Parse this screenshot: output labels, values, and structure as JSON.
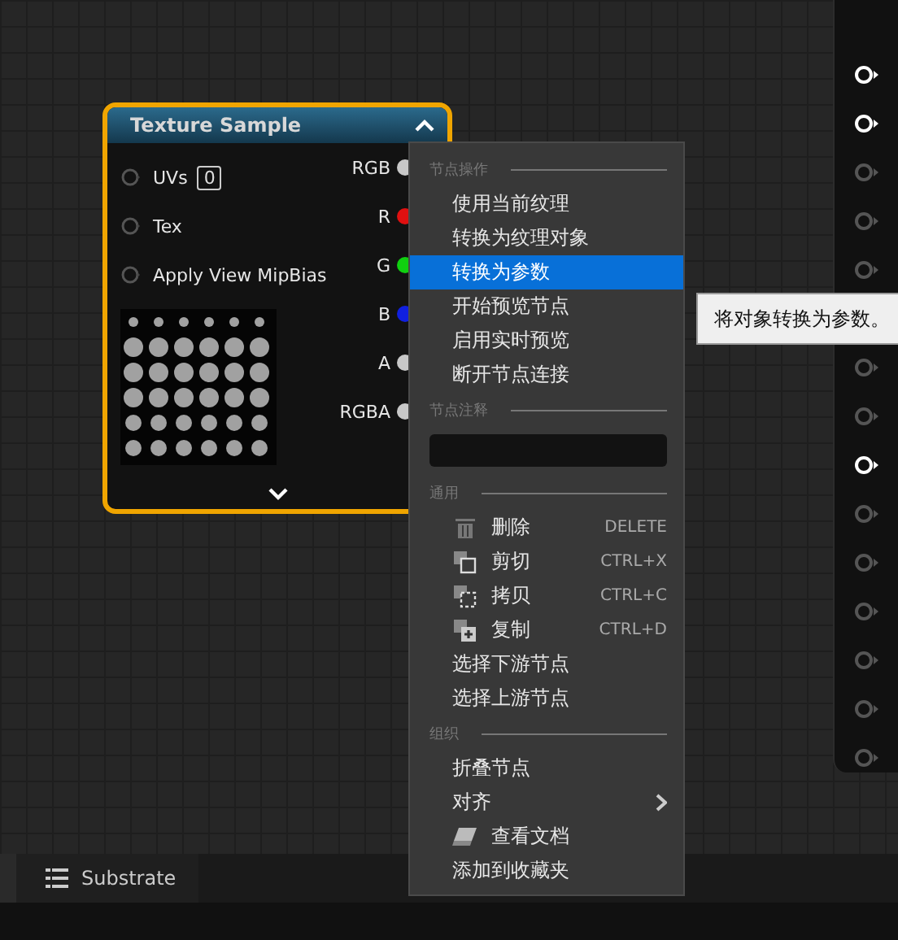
{
  "node": {
    "title": "Texture Sample",
    "inputs": [
      {
        "label": "UVs",
        "value": "0"
      },
      {
        "label": "Tex"
      },
      {
        "label": "Apply View MipBias"
      }
    ],
    "outputs": [
      {
        "label": "RGB",
        "color": "#c8c8c8"
      },
      {
        "label": "R",
        "color": "#e01010"
      },
      {
        "label": "G",
        "color": "#10d010"
      },
      {
        "label": "B",
        "color": "#1020e0"
      },
      {
        "label": "A",
        "color": "#c8c8c8"
      },
      {
        "label": "RGBA",
        "color": "#c8c8c8"
      }
    ]
  },
  "menu": {
    "sections": [
      {
        "header": "节点操作",
        "items": [
          {
            "kind": "text",
            "label": "使用当前纹理",
            "selected": false
          },
          {
            "kind": "text",
            "label": "转换为纹理对象",
            "selected": false
          },
          {
            "kind": "text",
            "label": "转换为参数",
            "selected": true
          },
          {
            "kind": "text",
            "label": "开始预览节点",
            "selected": false
          },
          {
            "kind": "text",
            "label": "启用实时预览",
            "selected": false
          },
          {
            "kind": "text",
            "label": "断开节点连接",
            "selected": false
          }
        ]
      },
      {
        "header": "节点注释",
        "items": [
          {
            "kind": "field"
          }
        ]
      },
      {
        "header": "通用",
        "items": [
          {
            "kind": "delete",
            "label": "删除",
            "shortcut": "DELETE",
            "selected": false
          },
          {
            "kind": "cut",
            "label": "剪切",
            "shortcut": "CTRL+X",
            "selected": false
          },
          {
            "kind": "copy",
            "label": "拷贝",
            "shortcut": "CTRL+C",
            "selected": false
          },
          {
            "kind": "duplicate",
            "label": "复制",
            "shortcut": "CTRL+D",
            "selected": false
          },
          {
            "kind": "text",
            "label": "选择下游节点",
            "selected": false
          },
          {
            "kind": "text",
            "label": "选择上游节点",
            "selected": false
          }
        ]
      },
      {
        "header": "组织",
        "items": [
          {
            "kind": "text",
            "label": "折叠节点",
            "selected": false
          },
          {
            "kind": "submenu",
            "label": "对齐",
            "selected": false
          },
          {
            "kind": "docs",
            "label": "查看文档",
            "selected": false
          },
          {
            "kind": "text",
            "label": "添加到收藏夹",
            "selected": false
          }
        ]
      }
    ]
  },
  "tooltip": "将对象转换为参数。",
  "panel": {
    "pins": [
      {
        "active": true
      },
      {
        "active": true
      },
      {
        "active": false
      },
      {
        "active": false
      },
      {
        "active": false
      },
      {
        "active": false
      },
      {
        "active": false
      },
      {
        "active": true
      },
      {
        "active": false
      },
      {
        "active": false
      },
      {
        "active": false
      },
      {
        "active": false
      },
      {
        "active": false
      },
      {
        "active": false
      }
    ]
  },
  "bottom_tab": "Substrate"
}
